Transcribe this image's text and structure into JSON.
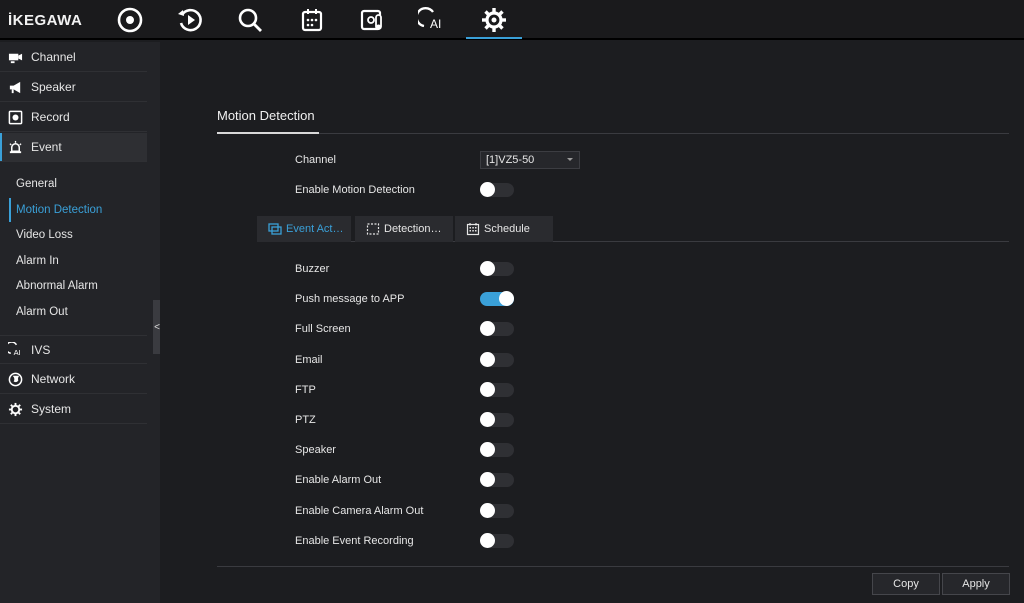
{
  "brand": {
    "logo_text": "İKEGAWA"
  },
  "topbar": {
    "icons": [
      "live-view-icon",
      "playback-icon",
      "search-icon",
      "calendar-icon",
      "thermal-icon",
      "ai-icon",
      "settings-icon"
    ],
    "active": "settings-icon",
    "accent": "#3aa0d8"
  },
  "sidebar": {
    "items": [
      {
        "label": "Channel",
        "icon": "camera-icon"
      },
      {
        "label": "Speaker",
        "icon": "megaphone-icon"
      },
      {
        "label": "Record",
        "icon": "record-icon"
      },
      {
        "label": "Event",
        "icon": "alarm-icon"
      }
    ],
    "event_sub": [
      {
        "label": "General"
      },
      {
        "label": "Motion Detection"
      },
      {
        "label": "Video Loss"
      },
      {
        "label": "Alarm In"
      },
      {
        "label": "Abnormal Alarm"
      },
      {
        "label": "Alarm Out"
      }
    ],
    "lower_items": [
      {
        "label": "IVS",
        "icon": "ai-icon"
      },
      {
        "label": "Network",
        "icon": "globe-icon"
      },
      {
        "label": "System",
        "icon": "gear-icon"
      }
    ],
    "collapse_label": "<"
  },
  "main": {
    "section_title": "Motion Detection",
    "channel_label": "Channel",
    "channel_value": "[1]VZ5-50",
    "enable_label": "Enable Motion Detection",
    "enable_on": false,
    "tabs": [
      {
        "label": "Event Act…",
        "icon": "event-action-icon"
      },
      {
        "label": "Detection…",
        "icon": "detection-area-icon"
      },
      {
        "label": "Schedule",
        "icon": "schedule-icon"
      }
    ],
    "options": [
      {
        "label": "Buzzer",
        "on": false
      },
      {
        "label": "Push message to APP",
        "on": true
      },
      {
        "label": "Full Screen",
        "on": false
      },
      {
        "label": "Email",
        "on": false
      },
      {
        "label": "FTP",
        "on": false
      },
      {
        "label": "PTZ",
        "on": false
      },
      {
        "label": "Speaker",
        "on": false
      },
      {
        "label": "Enable Alarm Out",
        "on": false
      },
      {
        "label": "Enable Camera Alarm Out",
        "on": false
      },
      {
        "label": "Enable Event Recording",
        "on": false
      }
    ],
    "buttons": {
      "copy": "Copy",
      "apply": "Apply"
    }
  }
}
